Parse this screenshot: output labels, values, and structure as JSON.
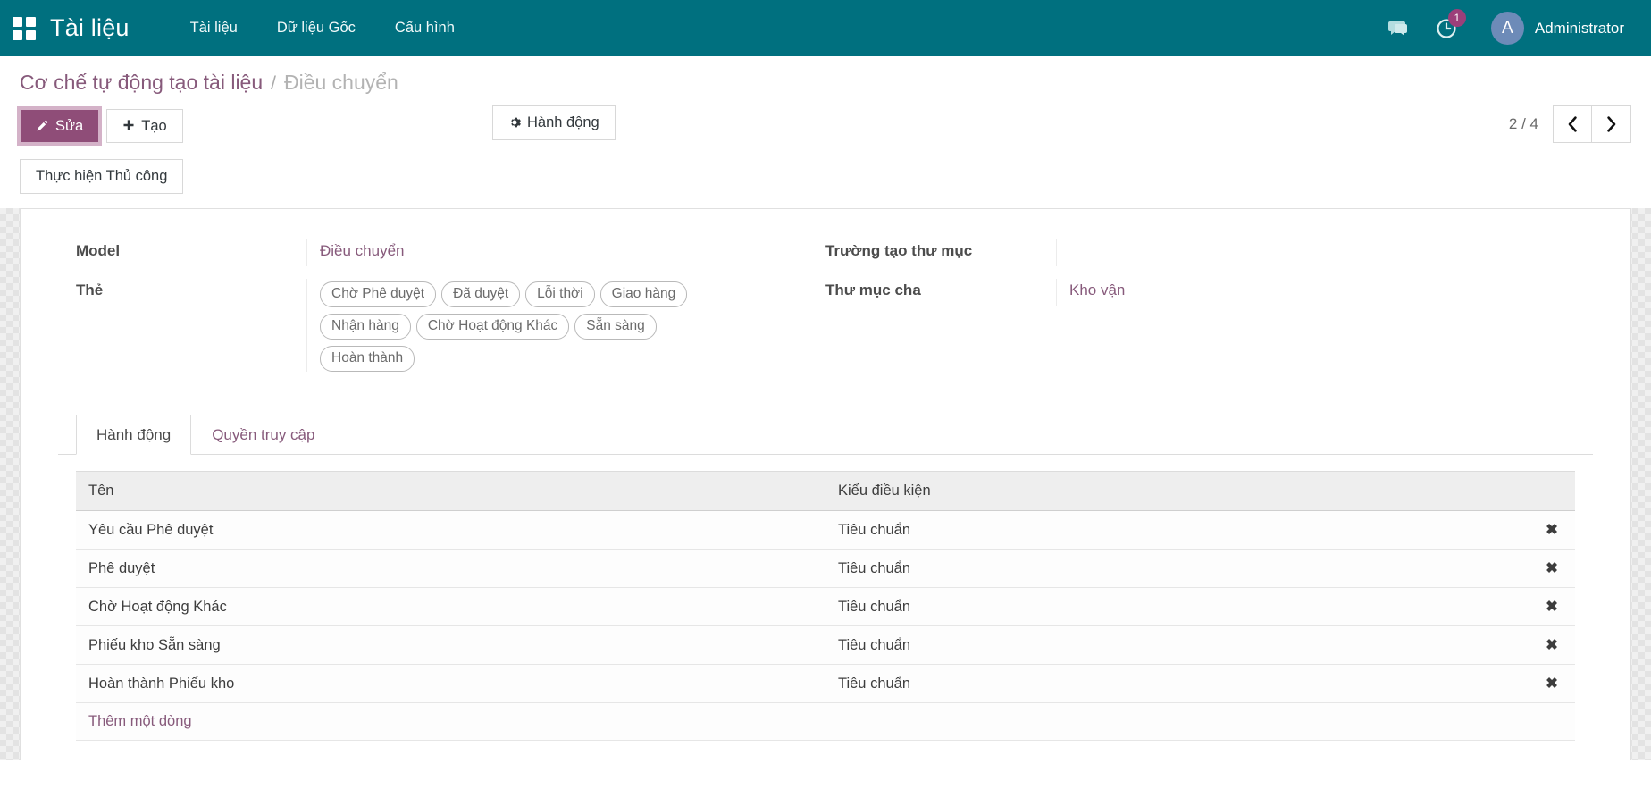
{
  "navbar": {
    "apps_icon": "apps-grid-icon",
    "brand": "Tài liệu",
    "menu": [
      {
        "label": "Tài liệu"
      },
      {
        "label": "Dữ liệu Gốc"
      },
      {
        "label": "Cấu hình"
      }
    ],
    "messages_icon": "messages-icon",
    "activity_icon": "activity-clock-icon",
    "activity_count": "1",
    "avatar_initial": "A",
    "user_name": "Administrator",
    "bg_color": "#00707f",
    "badge_color": "#9c3f7a"
  },
  "breadcrumb": {
    "root": "Cơ chế tự động tạo tài liệu",
    "separator": "/",
    "current": "Điều chuyển"
  },
  "control_panel": {
    "edit_label": "Sửa",
    "edit_icon": "pencil-icon",
    "create_label": "Tạo",
    "create_icon": "plus-icon",
    "action_label": "Hành động",
    "action_icon": "gear-icon",
    "manual_run_label": "Thực hiện Thủ công",
    "pager_text": "2 / 4",
    "prev_icon": "chevron-left-icon",
    "next_icon": "chevron-right-icon",
    "edit_color": "#8f4d78"
  },
  "form": {
    "left": [
      {
        "label": "Model",
        "value": "Điều chuyển",
        "is_link": true
      },
      {
        "label": "Thẻ",
        "value": "",
        "is_tags": true
      }
    ],
    "tags": [
      "Chờ Phê duyệt",
      "Đã duyệt",
      "Lỗi thời",
      "Giao hàng",
      "Nhận hàng",
      "Chờ Hoạt động Khác",
      "Sẵn sàng",
      "Hoàn thành"
    ],
    "right": [
      {
        "label": "Trường tạo thư mục",
        "value": "",
        "is_link": false
      },
      {
        "label": "Thư mục cha",
        "value": "Kho vận",
        "is_link": true
      }
    ]
  },
  "notebook": {
    "tabs": [
      {
        "label": "Hành động",
        "active": true
      },
      {
        "label": "Quyền truy cập",
        "active": false
      }
    ]
  },
  "table": {
    "columns": [
      "Tên",
      "Kiểu điều kiện"
    ],
    "delete_icon": "close-x-icon",
    "rows": [
      {
        "name": "Yêu cầu Phê duyệt",
        "condition": "Tiêu chuẩn"
      },
      {
        "name": "Phê duyệt",
        "condition": "Tiêu chuẩn"
      },
      {
        "name": "Chờ Hoạt động Khác",
        "condition": "Tiêu chuẩn"
      },
      {
        "name": "Phiếu kho Sẵn sàng",
        "condition": "Tiêu chuẩn"
      },
      {
        "name": "Hoàn thành Phiếu kho",
        "condition": "Tiêu chuẩn"
      }
    ],
    "add_line_label": "Thêm một dòng"
  }
}
